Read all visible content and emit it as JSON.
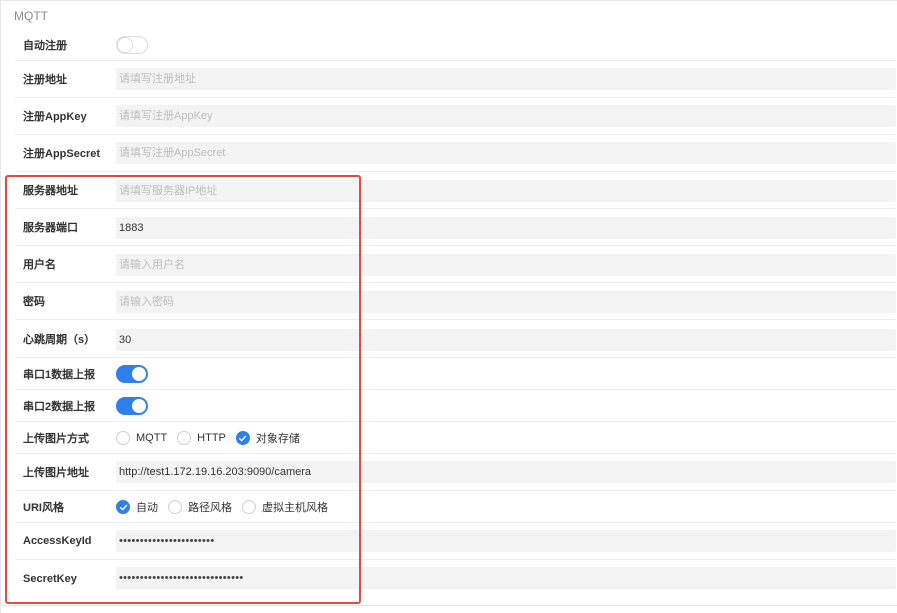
{
  "section": {
    "title": "MQTT"
  },
  "form": {
    "auto_register": {
      "label": "自动注册",
      "on": false
    },
    "register_address": {
      "label": "注册地址",
      "value": "",
      "placeholder": "请填写注册地址"
    },
    "register_appkey": {
      "label": "注册AppKey",
      "value": "",
      "placeholder": "请填写注册AppKey"
    },
    "register_appsecret": {
      "label": "注册AppSecret",
      "value": "",
      "placeholder": "请填写注册AppSecret"
    },
    "server_address": {
      "label": "服务器地址",
      "value": "",
      "placeholder": "请填写服务器IP地址"
    },
    "server_port": {
      "label": "服务器端口",
      "value": "1883",
      "placeholder": ""
    },
    "username": {
      "label": "用户名",
      "value": "",
      "placeholder": "请输入用户名"
    },
    "password": {
      "label": "密码",
      "value": "",
      "placeholder": "请输入密码"
    },
    "heartbeat": {
      "label": "心跳周期（s）",
      "value": "30",
      "placeholder": ""
    },
    "serial1_report": {
      "label": "串口1数据上报",
      "on": true
    },
    "serial2_report": {
      "label": "串口2数据上报",
      "on": true
    },
    "upload_method": {
      "label": "上传图片方式",
      "options": [
        "MQTT",
        "HTTP",
        "对象存储"
      ],
      "selected": "对象存储"
    },
    "upload_address": {
      "label": "上传图片地址",
      "value": "http://test1.172.19.16.203:9090/camera",
      "placeholder": ""
    },
    "uri_style": {
      "label": "URI风格",
      "options": [
        "自动",
        "路径风格",
        "虚拟主机风格"
      ],
      "selected": "自动"
    },
    "access_key_id": {
      "label": "AccessKeyId",
      "value": "•••••••••••••••••••••••"
    },
    "secret_key": {
      "label": "SecretKey",
      "value": "••••••••••••••••••••••••••••••"
    }
  },
  "colors": {
    "accent": "#2f80ed",
    "highlight": "#e24a42"
  }
}
